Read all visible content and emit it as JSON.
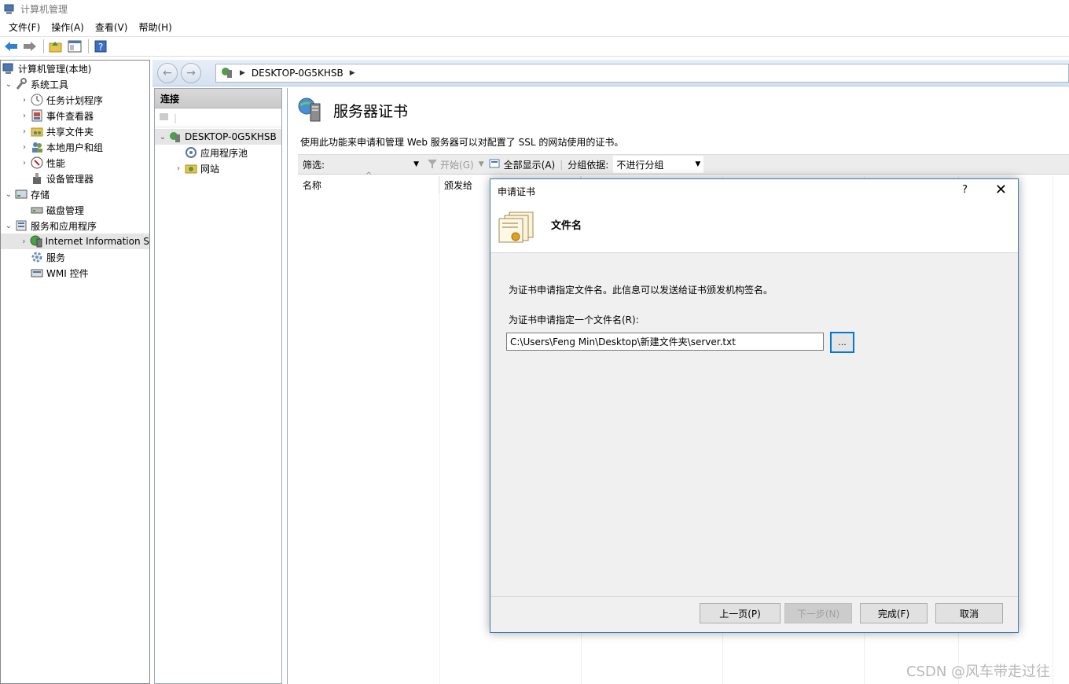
{
  "window": {
    "title": "计算机管理"
  },
  "menu": [
    {
      "label": "文件(F)"
    },
    {
      "label": "操作(A)"
    },
    {
      "label": "查看(V)"
    },
    {
      "label": "帮助(H)"
    }
  ],
  "tree": {
    "root": "计算机管理(本地)",
    "system_tools": "系统工具",
    "task_scheduler": "任务计划程序",
    "event_viewer": "事件查看器",
    "shared_folders": "共享文件夹",
    "local_users": "本地用户和组",
    "performance": "性能",
    "device_manager": "设备管理器",
    "storage": "存储",
    "disk_management": "磁盘管理",
    "services_apps": "服务和应用程序",
    "iis": "Internet Information S",
    "services": "服务",
    "wmi": "WMI 控件"
  },
  "iis": {
    "address": "DESKTOP-0G5KHSB",
    "connections_title": "连接",
    "server_node": "DESKTOP-0G5KHSB",
    "app_pools": "应用程序池",
    "sites": "网站",
    "feature_title": "服务器证书",
    "feature_desc": "使用此功能来申请和管理 Web 服务器可以对配置了 SSL 的网站使用的证书。",
    "filter_label": "筛选:",
    "start_label": "开始(G)",
    "show_all_label": "全部显示(A)",
    "group_by_label": "分组依据:",
    "group_by_value": "不进行分组",
    "col_name": "名称",
    "col_issued_to": "颁发给"
  },
  "dialog": {
    "title": "申请证书",
    "help": "?",
    "close": "✕",
    "header": "文件名",
    "description": "为证书申请指定文件名。此信息可以发送给证书颁发机构签名。",
    "field_label": "为证书申请指定一个文件名(R):",
    "file_path": "C:\\Users\\Feng Min\\Desktop\\新建文件夹\\server.txt",
    "browse": "...",
    "prev": "上一页(P)",
    "next": "下一步(N)",
    "finish": "完成(F)",
    "cancel": "取消"
  },
  "watermark": "CSDN @风车带走过往",
  "colors": {
    "accent": "#0078d7",
    "dialog_border": "#3c7fb1"
  }
}
